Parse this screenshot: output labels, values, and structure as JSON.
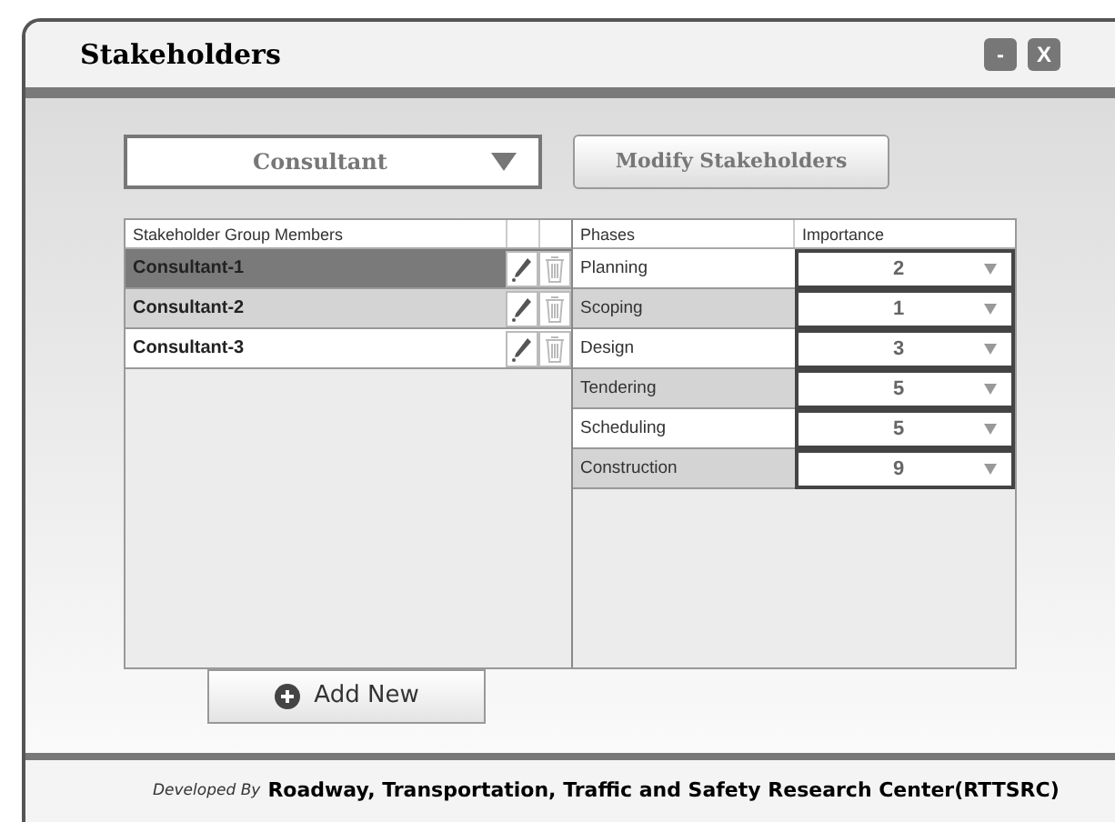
{
  "window": {
    "title": "Stakeholders",
    "controls": [
      "-",
      "X"
    ]
  },
  "group_dropdown": {
    "value": "Consultant"
  },
  "modify_button": {
    "label": "Modify Stakeholders"
  },
  "members_table": {
    "columns": [
      "Stakeholder Group Members"
    ],
    "rows": [
      {
        "name": "Consultant-1",
        "selected": true
      },
      {
        "name": "Consultant-2",
        "selected": false
      },
      {
        "name": "Consultant-3",
        "selected": false
      }
    ]
  },
  "phases_table": {
    "columns": [
      "Phases",
      "Importance"
    ],
    "rows": [
      {
        "phase": "Planning",
        "importance": "2"
      },
      {
        "phase": "Scoping",
        "importance": "1"
      },
      {
        "phase": "Design",
        "importance": "3"
      },
      {
        "phase": "Tendering",
        "importance": "5"
      },
      {
        "phase": "Scheduling",
        "importance": "5"
      },
      {
        "phase": "Construction",
        "importance": "9"
      }
    ]
  },
  "add_button": {
    "label": "Add New"
  },
  "footer": {
    "prefix": "Developed By",
    "organization": "Roadway, Transportation, Traffic and Safety Research Center(RTTSRC)"
  }
}
